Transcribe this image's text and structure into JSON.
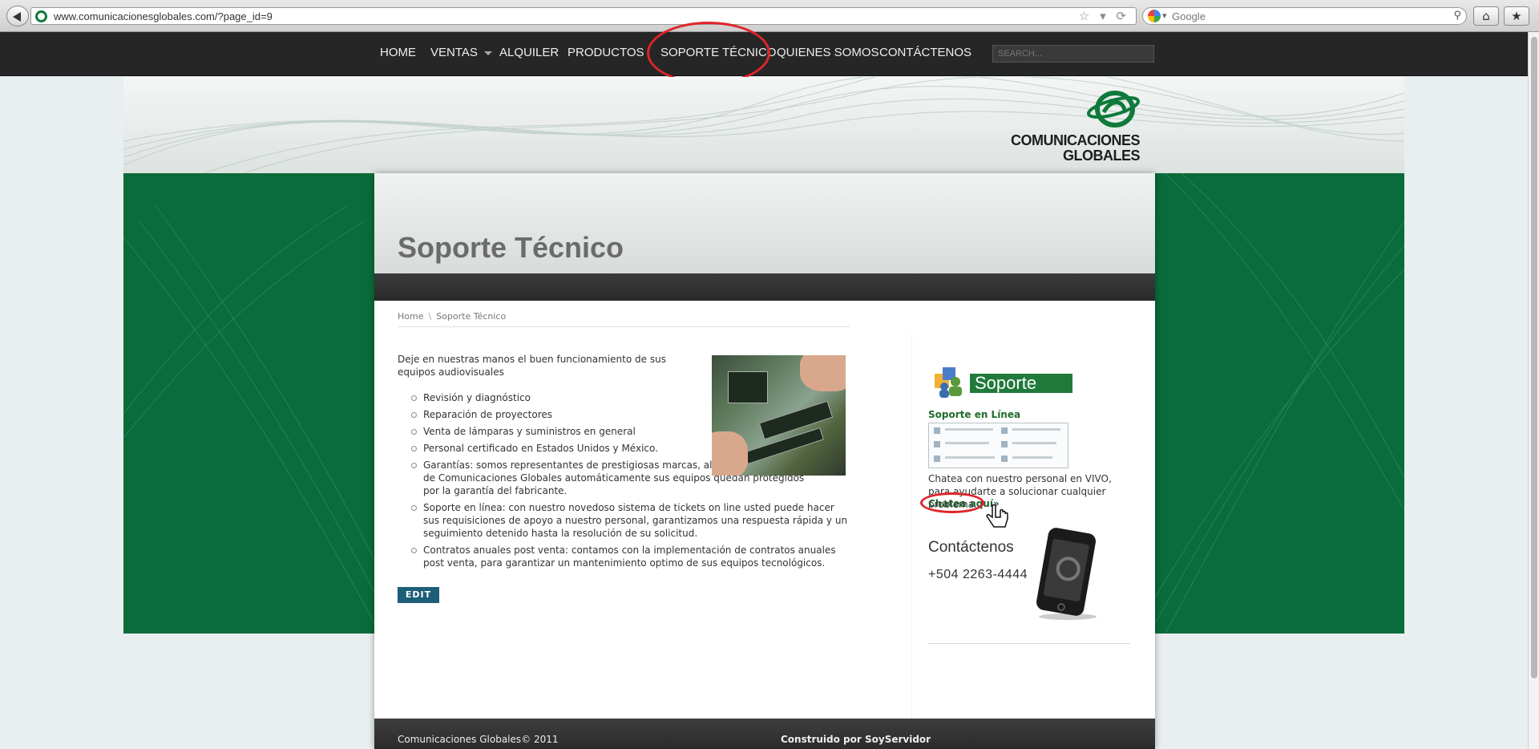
{
  "browser": {
    "url": "www.comunicacionesglobales.com/?page_id=9",
    "search_engine": "Google"
  },
  "nav": {
    "items": [
      {
        "label": "HOME"
      },
      {
        "label": "VENTAS",
        "has_dropdown": true
      },
      {
        "label": "ALQUILER"
      },
      {
        "label": "PRODUCTOS"
      },
      {
        "label": "SOPORTE TÉCNICO",
        "active": true
      },
      {
        "label": "QUIENES SOMOS"
      },
      {
        "label": "CONTÁCTENOS"
      }
    ],
    "search_placeholder": "SEARCH..."
  },
  "logo": {
    "line1": "COMUNICACIONES",
    "line2": "GLOBALES"
  },
  "page": {
    "title": "Soporte Técnico",
    "breadcrumb": [
      "Home",
      "\\",
      "Soporte Técnico"
    ],
    "intro": "Deje en nuestras manos el buen funcionamiento de sus equipos audiovisuales",
    "services": [
      "Revisión y diagnóstico",
      "Reparación de proyectores",
      "Venta de lámparas y suministros en general",
      "Personal certificado en Estados Unidos y México.",
      "Garantías: somos representantes de prestigiosas marcas, al adquirirlas a través de Comunicaciones Globales automáticamente sus equipos quedan protegidos por la garantía del fabricante.",
      "Soporte en línea: con nuestro novedoso sistema de tickets on line usted puede hacer sus requisiciones de apoyo a nuestro personal, garantizamos una respuesta rápida y un seguimiento detenido hasta la resolución de su solicitud.",
      "Contratos anuales post venta: contamos con la implementación de contratos anuales post venta, para garantizar un mantenimiento optimo de sus equipos tecnológicos."
    ],
    "edit_label": "EDIT"
  },
  "sidebar": {
    "banner_label": "Soporte",
    "online_title": "Soporte en Línea",
    "chat_text": "Chatea con nuestro personal en VIVO, para ayudarte a solucionar cualquier problema.",
    "chat_link": "Chatea aquí»",
    "contact_title": "Contáctenos",
    "phone": "+504 2263-4444"
  },
  "footer": {
    "copyright": "Comunicaciones Globales© 2011",
    "built_by": "Construido por SoyServidor"
  },
  "colors": {
    "brand_green": "#0a6b3b",
    "nav_bg": "#262626",
    "edit_button": "#1d5e78",
    "highlight_red": "#e0252a"
  }
}
